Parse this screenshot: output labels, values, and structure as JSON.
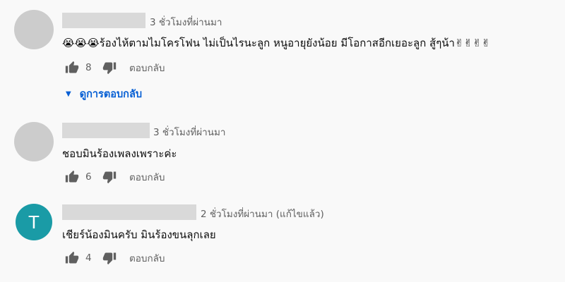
{
  "comments": [
    {
      "time": "3 ชั่วโมงที่ผ่านมา",
      "prefix_emojis": [
        "😭",
        "😭",
        "😭"
      ],
      "text": "ร้องไห้ตามไมโครโฟน ไม่เป็นไรนะลูก หนูอายุยังน้อย มีโอกาสอีกเยอะลูก สู้ๆน้า",
      "suffix_emojis": [
        "✌",
        "✌",
        "✌",
        "✌"
      ],
      "likes": "8",
      "reply_label": "ตอบกลับ",
      "view_replies_label": "ดูการตอบกลับ"
    },
    {
      "time": "3 ชั่วโมงที่ผ่านมา",
      "text": "ชอบมินร้องเพลงเพราะค่ะ",
      "likes": "6",
      "reply_label": "ตอบกลับ"
    },
    {
      "avatar_letter": "T",
      "avatar_color": "#1a9ba6",
      "time": "2 ชั่วโมงที่ผ่านมา (แก้ไขแล้ว)",
      "text": "เชียร์น้องมินครับ มินร้องขนลุกเลย",
      "likes": "4",
      "reply_label": "ตอบกลับ"
    }
  ],
  "colors": {
    "background": "#f9f9f9",
    "link": "#065fd4",
    "muted_text": "#606060",
    "redacted_name": "#d9d9d9"
  },
  "icons": {
    "like": "thumbs-up-icon",
    "dislike": "thumbs-down-icon",
    "expand": "caret-down-icon"
  }
}
